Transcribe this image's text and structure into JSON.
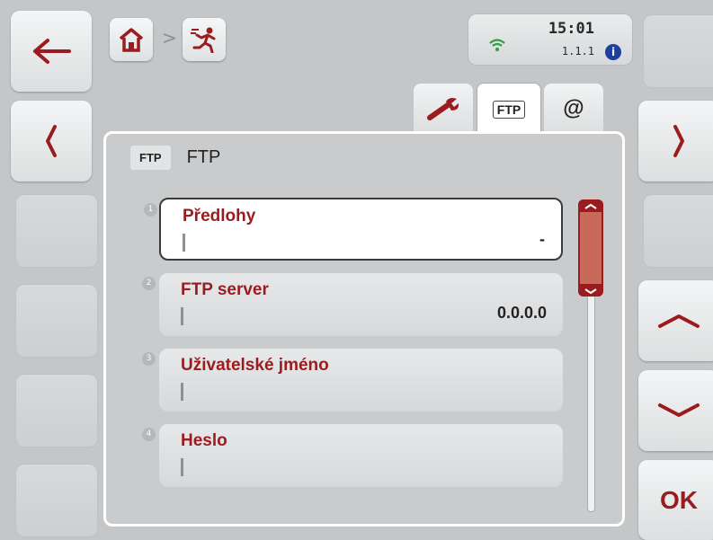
{
  "status": {
    "time": "15:01",
    "version": "1.1.1",
    "info_glyph": "i"
  },
  "breadcrumb": {
    "separator": ">"
  },
  "tabs": [
    {
      "name": "settings-tab",
      "icon": "wrench-icon"
    },
    {
      "name": "ftp-tab",
      "label": "FTP",
      "active": true
    },
    {
      "name": "email-tab",
      "label": "@"
    }
  ],
  "panel": {
    "badge": "FTP",
    "title": "FTP"
  },
  "fields": [
    {
      "num": "1",
      "label": "Předlohy",
      "value": "-",
      "selected": true
    },
    {
      "num": "2",
      "label": "FTP server",
      "value": "0.0.0.0"
    },
    {
      "num": "3",
      "label": "Uživatelské jméno",
      "value": ""
    },
    {
      "num": "4",
      "label": "Heslo",
      "value": ""
    }
  ],
  "right_buttons": {
    "ok_label": "OK"
  },
  "colors": {
    "accent": "#9b1c1f",
    "scroll": "#c76a5a"
  }
}
